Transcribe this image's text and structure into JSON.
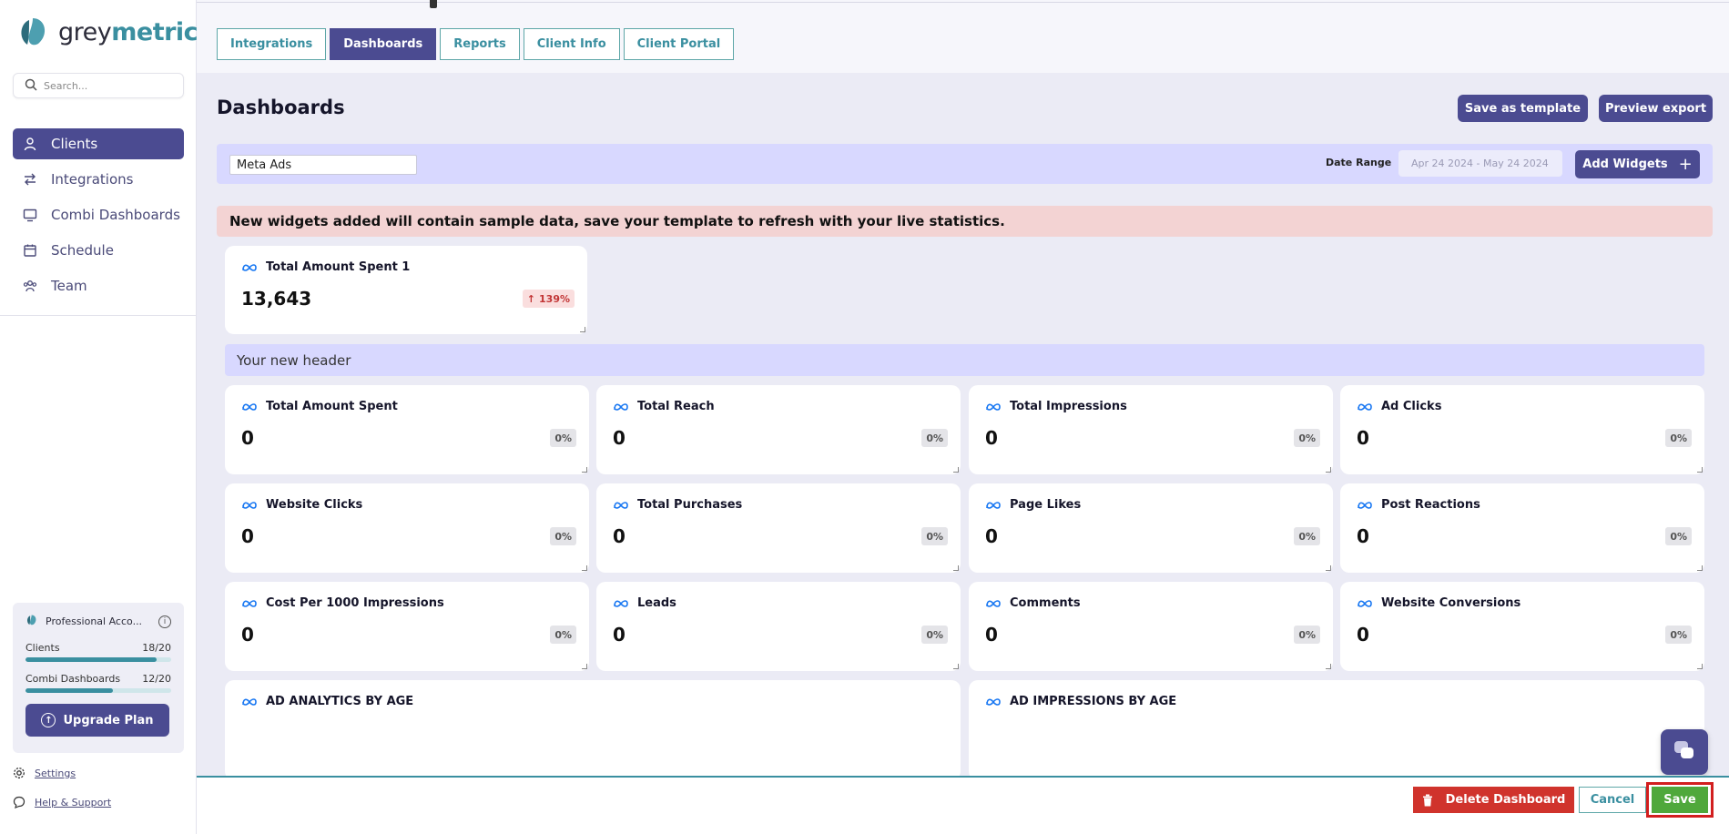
{
  "brand": {
    "part1": "grey",
    "part2": "metrics"
  },
  "search": {
    "placeholder": "Search..."
  },
  "sidebar": {
    "items": [
      {
        "label": "Clients",
        "icon": "user-icon",
        "active": true
      },
      {
        "label": "Integrations",
        "icon": "arrows-swap-icon",
        "active": false
      },
      {
        "label": "Combi Dashboards",
        "icon": "monitor-icon",
        "active": false
      },
      {
        "label": "Schedule",
        "icon": "calendar-icon",
        "active": false
      },
      {
        "label": "Team",
        "icon": "team-icon",
        "active": false
      }
    ],
    "plan": {
      "name": "Professional Acco...",
      "usage": [
        {
          "label": "Clients",
          "used": 18,
          "total": 20,
          "text": "18/20"
        },
        {
          "label": "Combi Dashboards",
          "used": 12,
          "total": 20,
          "text": "12/20"
        }
      ],
      "upgrade_label": "Upgrade Plan"
    },
    "settings_label": "Settings",
    "help_label": "Help & Support"
  },
  "tabs": [
    {
      "label": "Integrations",
      "active": false
    },
    {
      "label": "Dashboards",
      "active": true
    },
    {
      "label": "Reports",
      "active": false
    },
    {
      "label": "Client Info",
      "active": false
    },
    {
      "label": "Client Portal",
      "active": false
    }
  ],
  "main": {
    "title": "Dashboards",
    "save_template_label": "Save as template",
    "preview_export_label": "Preview export",
    "dashboard_name": "Meta Ads",
    "date_range_label": "Date Range",
    "date_range_value": "Apr 24 2024 - May 24 2024",
    "add_widgets_label": "Add Widgets",
    "notice": "New widgets added will contain sample data, save your template to refresh with your live statistics.",
    "section_header": "Your new header"
  },
  "top_widget": {
    "title": "Total Amount Spent 1",
    "value": "13,643",
    "change": "139%"
  },
  "widgets": [
    {
      "title": "Total Amount Spent",
      "value": "0",
      "change": "0%"
    },
    {
      "title": "Total Reach",
      "value": "0",
      "change": "0%"
    },
    {
      "title": "Total Impressions",
      "value": "0",
      "change": "0%"
    },
    {
      "title": "Ad Clicks",
      "value": "0",
      "change": "0%"
    },
    {
      "title": "Website Clicks",
      "value": "0",
      "change": "0%"
    },
    {
      "title": "Total Purchases",
      "value": "0",
      "change": "0%"
    },
    {
      "title": "Page Likes",
      "value": "0",
      "change": "0%"
    },
    {
      "title": "Post Reactions",
      "value": "0",
      "change": "0%"
    },
    {
      "title": "Cost Per 1000 Impressions",
      "value": "0",
      "change": "0%"
    },
    {
      "title": "Leads",
      "value": "0",
      "change": "0%"
    },
    {
      "title": "Comments",
      "value": "0",
      "change": "0%"
    },
    {
      "title": "Website Conversions",
      "value": "0",
      "change": "0%"
    }
  ],
  "chart_widgets": [
    {
      "title": "AD ANALYTICS BY AGE"
    },
    {
      "title": "AD IMPRESSIONS BY AGE"
    }
  ],
  "bottom": {
    "delete_label": "Delete Dashboard",
    "cancel_label": "Cancel",
    "save_label": "Save"
  },
  "colors": {
    "primary": "#4b4b91",
    "teal": "#3a8fa0",
    "danger": "#d0332c",
    "success": "#4fa83b",
    "meta": "#1877f2"
  }
}
